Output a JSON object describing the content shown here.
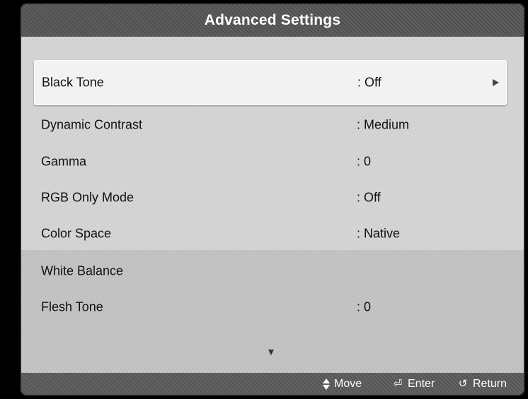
{
  "title": "Advanced Settings",
  "menu": {
    "items": [
      {
        "label": "Black Tone",
        "value": ": Off"
      },
      {
        "label": "Dynamic Contrast",
        "value": ": Medium"
      },
      {
        "label": "Gamma",
        "value": ": 0"
      },
      {
        "label": "RGB Only Mode",
        "value": ": Off"
      },
      {
        "label": "Color Space",
        "value": ": Native"
      },
      {
        "label": "White Balance",
        "value": ""
      },
      {
        "label": "Flesh Tone",
        "value": ": 0"
      }
    ]
  },
  "footer": {
    "move_label": "Move",
    "enter_label": "Enter",
    "return_label": "Return",
    "move_icon": "up-down-arrows-icon",
    "enter_icon": "enter-icon",
    "return_icon": "return-icon"
  },
  "colors": {
    "title_bar": "#555555",
    "selected_item": "#f2f2f2",
    "upper_bg": "#d6d6d6",
    "lower_bg": "#c4c4c4"
  }
}
